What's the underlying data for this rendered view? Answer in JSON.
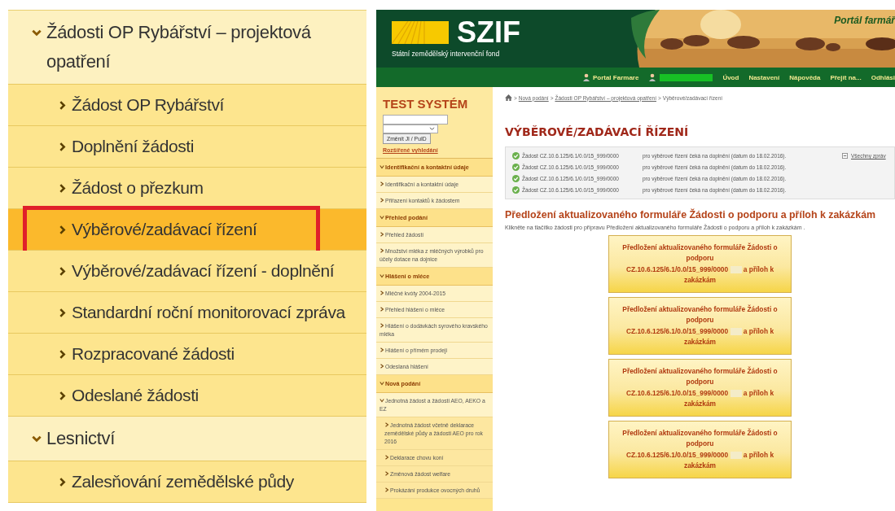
{
  "left_menu": [
    {
      "label": "Žádosti OP Rybářství – projektová opatření",
      "expanded": true,
      "children": [
        {
          "label": "Žádost OP Rybářství",
          "selected": false
        },
        {
          "label": "Doplnění žádosti",
          "selected": false
        },
        {
          "label": "Žádost o přezkum",
          "selected": false
        },
        {
          "label": "Výběrové/zadávací řízení",
          "selected": true
        },
        {
          "label": "Výběrové/zadávací řízení - doplnění",
          "selected": false
        },
        {
          "label": "Standardní roční monitorovací zpráva",
          "selected": false
        },
        {
          "label": "Rozpracované žádosti",
          "selected": false
        },
        {
          "label": "Odeslané žádosti",
          "selected": false
        }
      ]
    },
    {
      "label": "Lesnictví",
      "expanded": true,
      "children": [
        {
          "label": "Zalesňování zemědělské půdy",
          "selected": false
        }
      ]
    }
  ],
  "header": {
    "logo": "SZIF",
    "subtitle": "Státní zemědělský intervenční fond",
    "portal_title": "Portál farmář"
  },
  "nav": {
    "portal": "Portal Farmare",
    "links": [
      "Úvod",
      "Nastavení",
      "Nápověda",
      "Přejít na...",
      "Odhlási"
    ]
  },
  "breadcrumb_separator": ">",
  "breadcrumb": [
    "Nová podání",
    "Žádosti OP Rybářství – projektová opatření",
    "Výběrové/zadávací řízení"
  ],
  "sidebar": {
    "title": "TEST SYSTÉM",
    "change_button": "Změnit JI / PuID",
    "advanced_search": "Rozšířené vyhledání",
    "sections": [
      {
        "label": "Identifikační a kontaktní údaje",
        "expanded": true,
        "items": [
          {
            "label": "Identifikační a kontaktní údaje",
            "expanded": false
          },
          {
            "label": "Přiřazení kontaktů k žádostem",
            "expanded": false
          }
        ]
      },
      {
        "label": "Přehled podání",
        "expanded": true,
        "items": [
          {
            "label": "Přehled žádostí",
            "expanded": false
          },
          {
            "label": "Množství mléka z mléčných výrobků pro účely dotace na dojnice",
            "expanded": false
          }
        ]
      },
      {
        "label": "Hlášení o mléce",
        "expanded": true,
        "items": [
          {
            "label": "Mléčné kvóty 2004-2015",
            "expanded": false
          },
          {
            "label": "Přehled hlášení o mléce",
            "expanded": false
          },
          {
            "label": "Hlášení o dodávkách syrového kravského mléka",
            "expanded": false
          },
          {
            "label": "Hlášení o přímém prodeji",
            "expanded": false
          },
          {
            "label": "Odeslaná hlášení",
            "expanded": false
          }
        ]
      },
      {
        "label": "Nová podání",
        "expanded": true,
        "items": [
          {
            "label": "Jednotná žádost a žádosti AEO, AEKO a EZ",
            "expanded": true,
            "children": [
              {
                "label": "Jednotná žádost včetně deklarace zemědělské půdy a žádosti AEO pro rok 2016",
                "expanded": false
              },
              {
                "label": "Deklarace chovu koní",
                "expanded": false
              },
              {
                "label": "Změnová žádost welfare",
                "expanded": false
              },
              {
                "label": "Prokázání produkce ovocných druhů",
                "expanded": false
              }
            ]
          }
        ]
      }
    ]
  },
  "main": {
    "title": "VÝBĚROVÉ/ZADÁVACÍ ŘÍZENÍ",
    "messages": [
      {
        "request": "Žádost CZ.10.6.125/6.1/0.0/15_999/0000",
        "text": "pro výběrové řízení čeká na doplnění (datum do 18.02.2016)."
      },
      {
        "request": "Žádost CZ.10.6.125/6.1/0.0/15_999/0000",
        "text": "pro výběrové řízení čeká na doplnění (datum do 18.02.2016)."
      },
      {
        "request": "Žádost CZ.10.6.125/6.1/0.0/15_999/0000",
        "text": "pro výběrové řízení čeká na doplnění (datum do 18.02.2016)."
      },
      {
        "request": "Žádost CZ.10.6.125/6.1/0.0/15_999/0000",
        "text": "pro výběrové řízení čeká na doplnění (datum do 18.02.2016)."
      }
    ],
    "all_messages_link": "Všechny zpráv",
    "section_title": "Předložení aktualizovaného formuláře Žádosti o podporu a příloh k zakázkám",
    "instruction": "Klikněte na tlačítko žádosti pro přípravu Předložení aktualizovaného formuláře Žádosti o podporu a příloh k zakázkám .",
    "form_buttons": [
      {
        "title": "Předložení aktualizovaného formuláře Žádosti o podporu",
        "code": "CZ.10.6.125/6.1/0.0/15_999/0000",
        "suffix": "a příloh k zakázkám"
      },
      {
        "title": "Předložení aktualizovaného formuláře Žádosti o podporu",
        "code": "CZ.10.6.125/6.1/0.0/15_999/0000",
        "suffix": "a příloh k zakázkám"
      },
      {
        "title": "Předložení aktualizovaného formuláře Žádosti o podporu",
        "code": "CZ.10.6.125/6.1/0.0/15_999/0000",
        "suffix": "a příloh k zakázkám"
      },
      {
        "title": "Předložení aktualizovaného formuláře Žádosti o podporu",
        "code": "CZ.10.6.125/6.1/0.0/15_999/0000",
        "suffix": "a příloh k zakázkám"
      }
    ]
  }
}
